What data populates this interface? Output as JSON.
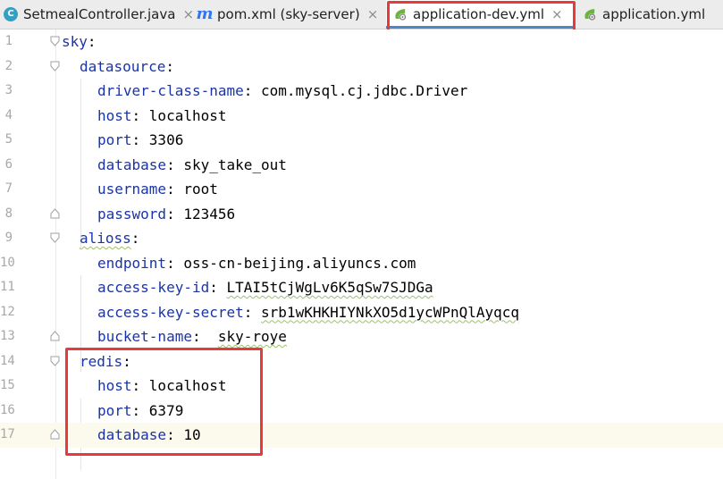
{
  "tabs": [
    {
      "label": "SetmealController.java",
      "icon": "java-class-icon",
      "active": false
    },
    {
      "label": "pom.xml (sky-server)",
      "icon": "maven-icon",
      "active": false
    },
    {
      "label": "application-dev.yml",
      "icon": "spring-yaml-icon",
      "active": true
    },
    {
      "label": "application.yml",
      "icon": "spring-yaml-icon",
      "active": false
    }
  ],
  "close_glyph": "×",
  "lines": [
    {
      "num": "1",
      "key": "sky",
      "sep": ":",
      "value": ""
    },
    {
      "num": "2",
      "key": "datasource",
      "sep": ":",
      "value": ""
    },
    {
      "num": "3",
      "key": "driver-class-name",
      "sep": ": ",
      "value": "com.mysql.cj.jdbc.Driver"
    },
    {
      "num": "4",
      "key": "host",
      "sep": ": ",
      "value": "localhost"
    },
    {
      "num": "5",
      "key": "port",
      "sep": ": ",
      "value": "3306"
    },
    {
      "num": "6",
      "key": "database",
      "sep": ": ",
      "value": "sky_take_out"
    },
    {
      "num": "7",
      "key": "username",
      "sep": ": ",
      "value": "root"
    },
    {
      "num": "8",
      "key": "password",
      "sep": ": ",
      "value": "123456"
    },
    {
      "num": "9",
      "key": "alioss",
      "sep": ":",
      "value": ""
    },
    {
      "num": "10",
      "key": "endpoint",
      "sep": ": ",
      "value": "oss-cn-beijing.aliyuncs.com"
    },
    {
      "num": "11",
      "key": "access-key-id",
      "sep": ": ",
      "value": "LTAI5tCjWgLv6K5qSw7SJDGa"
    },
    {
      "num": "12",
      "key": "access-key-secret",
      "sep": ": ",
      "value": "srb1wKHKHIYNkXO5d1ycWPnQlAyqcq"
    },
    {
      "num": "13",
      "key": "bucket-name",
      "sep": ":  ",
      "value": "sky-roye"
    },
    {
      "num": "14",
      "key": "redis",
      "sep": ":",
      "value": ""
    },
    {
      "num": "15",
      "key": "host",
      "sep": ": ",
      "value": "localhost"
    },
    {
      "num": "16",
      "key": "port",
      "sep": ": ",
      "value": "6379"
    },
    {
      "num": "17",
      "key": "database",
      "sep": ": ",
      "value": "10"
    }
  ],
  "colors": {
    "yaml_key": "#1a34a8",
    "highlight_box": "#e8393b",
    "current_line": "#fcfaed",
    "spring_green": "#6db33f"
  }
}
